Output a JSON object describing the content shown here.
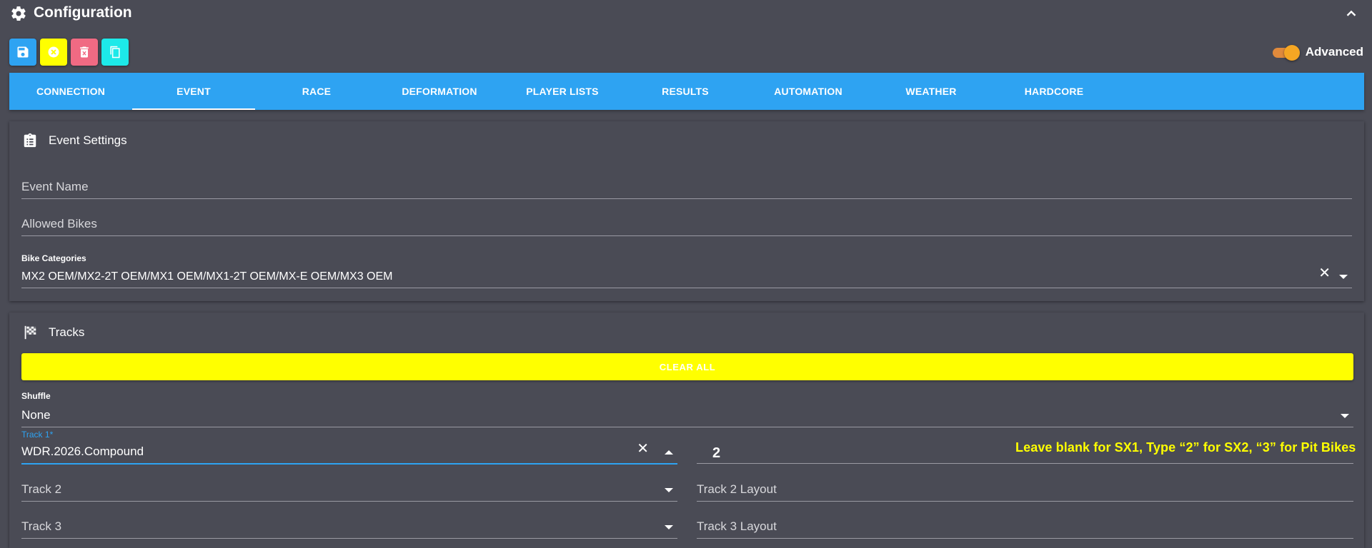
{
  "header": {
    "title": "Configuration",
    "gear_icon": "gear-icon",
    "collapse_icon": "chevron-up-icon"
  },
  "toolbar": {
    "buttons": [
      {
        "name": "save",
        "icon": "save-icon",
        "color": "#2ea3f2"
      },
      {
        "name": "cancel",
        "icon": "cancel-circle-icon",
        "color": "#ffff00"
      },
      {
        "name": "delete",
        "icon": "delete-icon",
        "color": "#f06a83"
      },
      {
        "name": "copy",
        "icon": "copy-icon",
        "color": "#1de9e9"
      }
    ]
  },
  "advanced": {
    "label": "Advanced",
    "enabled": true,
    "color": "#f5a623"
  },
  "tabs": [
    {
      "label": "CONNECTION",
      "active": false
    },
    {
      "label": "EVENT",
      "active": true
    },
    {
      "label": "RACE",
      "active": false
    },
    {
      "label": "DEFORMATION",
      "active": false
    },
    {
      "label": "PLAYER LISTS",
      "active": false
    },
    {
      "label": "RESULTS",
      "active": false
    },
    {
      "label": "AUTOMATION",
      "active": false
    },
    {
      "label": "WEATHER",
      "active": false
    },
    {
      "label": "HARDCORE",
      "active": false
    }
  ],
  "event_settings": {
    "title": "Event Settings",
    "event_name_placeholder": "Event Name",
    "allowed_bikes_placeholder": "Allowed Bikes",
    "bike_categories_label": "Bike Categories",
    "bike_categories_value": "MX2 OEM/MX2-2T OEM/MX1 OEM/MX1-2T OEM/MX-E OEM/MX3 OEM"
  },
  "tracks": {
    "title": "Tracks",
    "clear_all_label": "CLEAR ALL",
    "shuffle_label": "Shuffle",
    "shuffle_value": "None",
    "track1_label": "Track 1*",
    "track1_value": "WDR.2026.Compound",
    "track1_layout_value": "2",
    "hint": "Leave blank for SX1, Type “2” for SX2, “3” for Pit Bikes",
    "track2_placeholder": "Track 2",
    "track2_layout_placeholder": "Track 2 Layout",
    "track3_placeholder": "Track 3",
    "track3_layout_placeholder": "Track 3 Layout"
  },
  "colors": {
    "background": "#4a4b55",
    "accent": "#2ea3f2",
    "highlight": "#ffff00"
  }
}
